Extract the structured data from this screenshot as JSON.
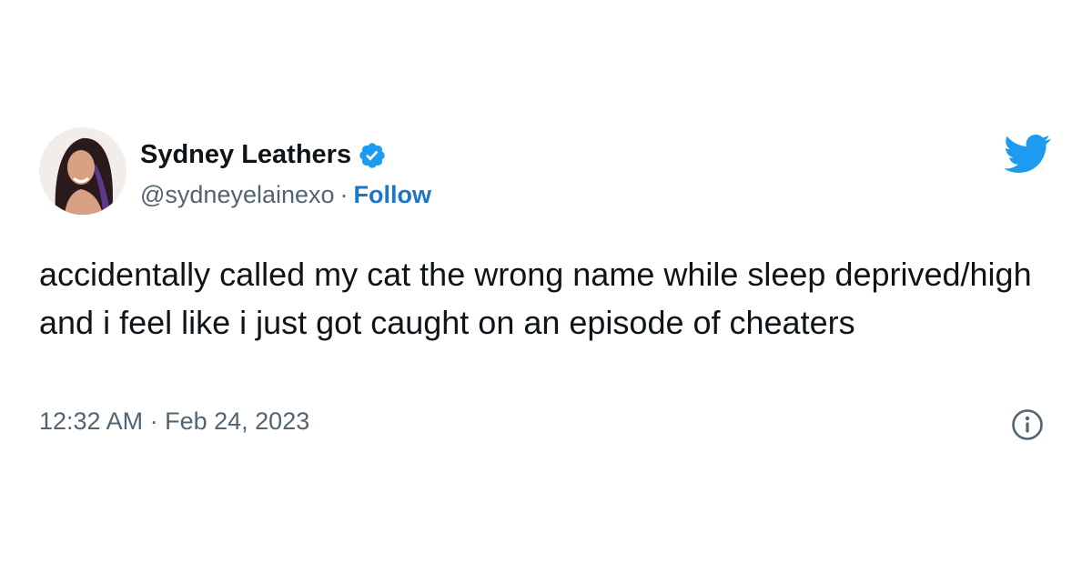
{
  "tweet": {
    "author": {
      "display_name": "Sydney Leathers",
      "handle": "@sydneyelainexo",
      "verified": true,
      "separator": "·",
      "follow_label": "Follow"
    },
    "text": "accidentally called my cat the wrong name while sleep deprived/high and i feel like i just got caught on an episode of cheaters",
    "time": "12:32 AM",
    "date_separator": "·",
    "date": "Feb 24, 2023",
    "icons": {
      "brand": "twitter-bird-icon",
      "verified": "verified-badge-icon",
      "info": "info-icon"
    }
  },
  "colors": {
    "brand_blue": "#1d9bf0",
    "follow_blue": "#1d74c9",
    "text": "#0f1419",
    "secondary": "#536471"
  }
}
